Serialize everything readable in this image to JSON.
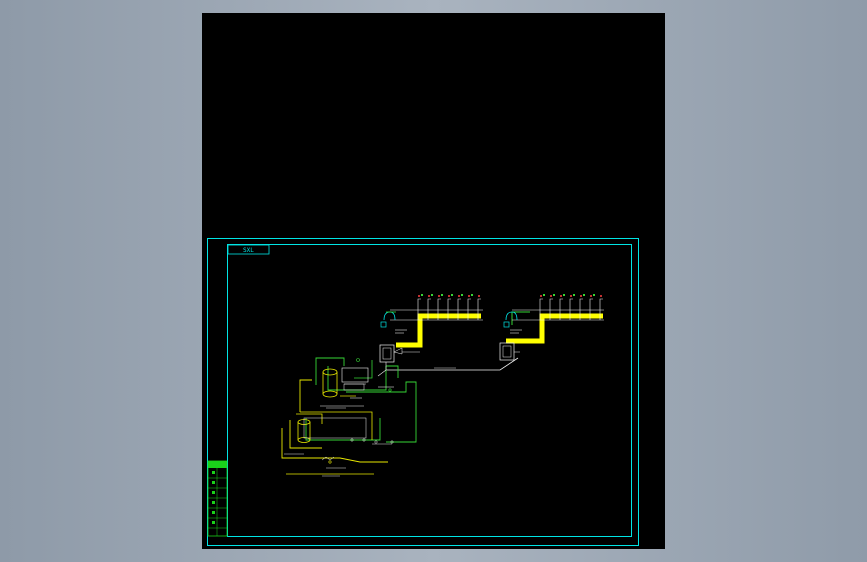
{
  "title_tag": "SXL",
  "colors": {
    "frame": "#00e5e5",
    "pipe_green": "#36d636",
    "pipe_yellow": "#e8e800",
    "pipe_white": "#f0f0f0",
    "riser_yellow": "#ffff00",
    "valve_red": "#ff4040",
    "title_block": "#1ad11a"
  }
}
